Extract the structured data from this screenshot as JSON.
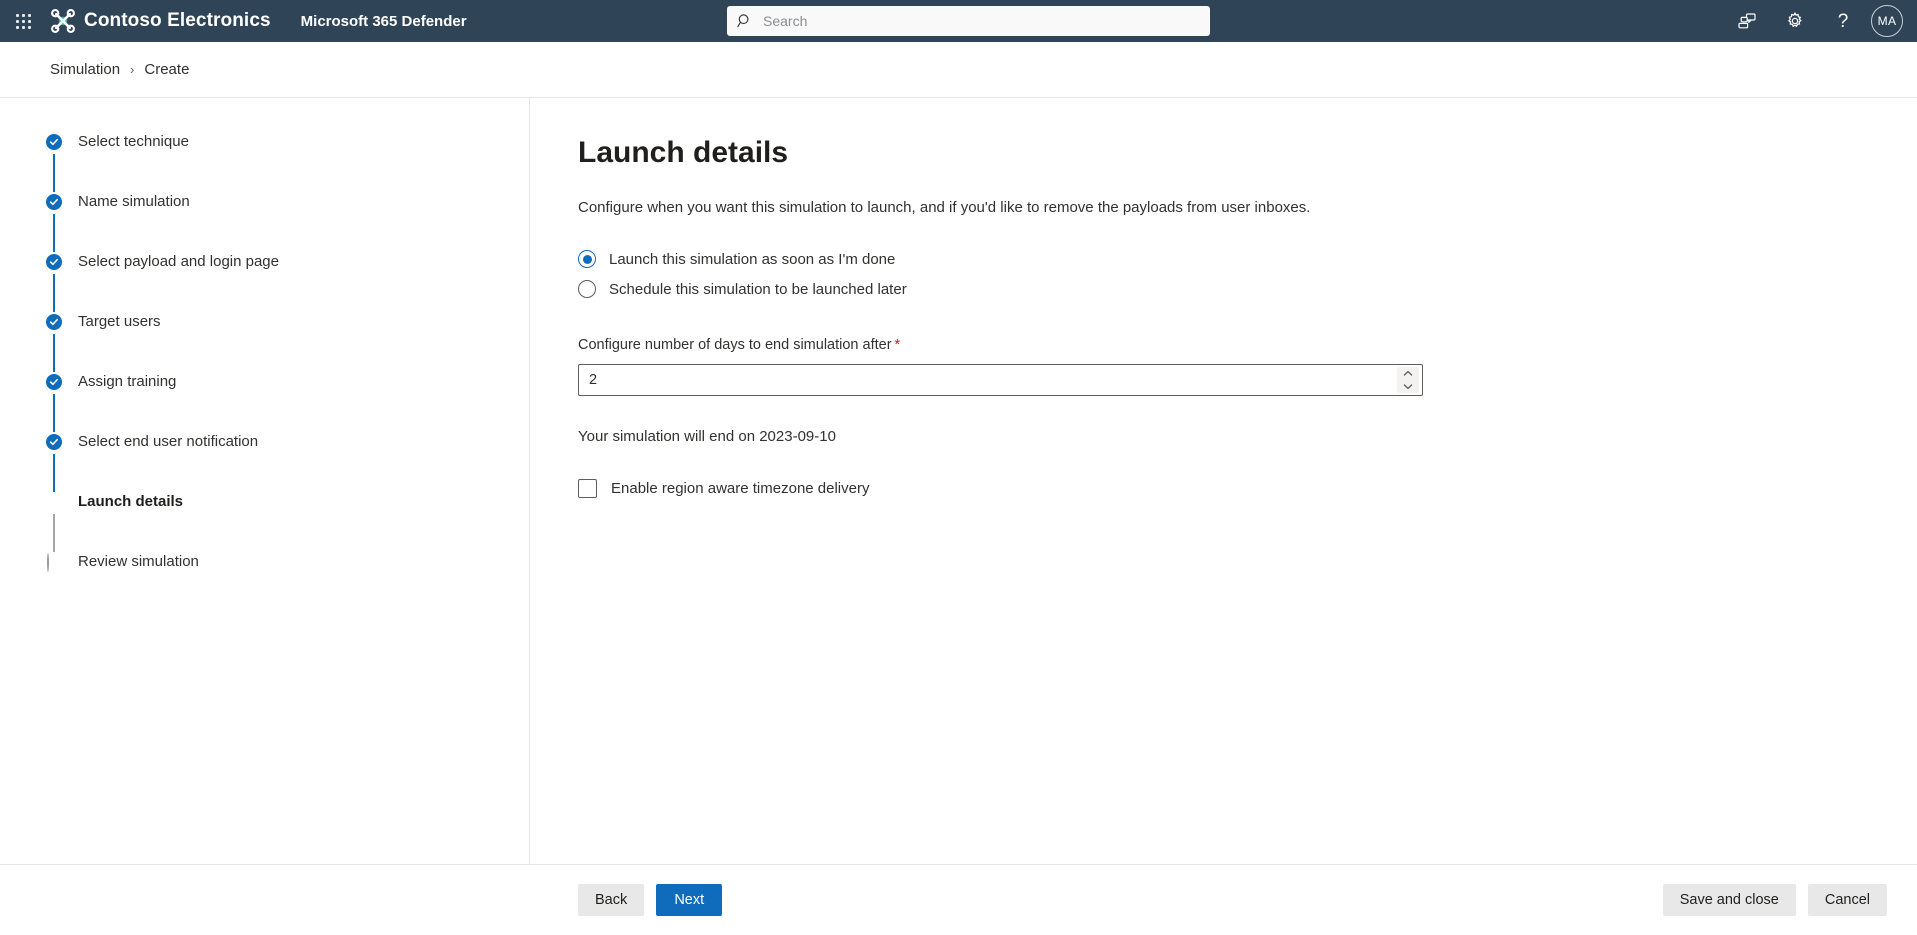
{
  "header": {
    "waffle_label": "App launcher",
    "brand_name": "Contoso Electronics",
    "app_name": "Microsoft 365 Defender",
    "search": {
      "placeholder": "Search",
      "value": ""
    },
    "actions": {
      "feedback_label": "Feedback",
      "settings_label": "Settings",
      "help_label": "?",
      "avatar_initials": "MA"
    },
    "background_color": "#2f4456"
  },
  "breadcrumb": {
    "separator": "›",
    "items": [
      {
        "label": "Simulation"
      },
      {
        "label": "Create"
      }
    ]
  },
  "wizard": {
    "steps": [
      {
        "label": "Select technique",
        "state": "done"
      },
      {
        "label": "Name simulation",
        "state": "done"
      },
      {
        "label": "Select payload and login page",
        "state": "done"
      },
      {
        "label": "Target users",
        "state": "done"
      },
      {
        "label": "Assign training",
        "state": "done"
      },
      {
        "label": "Select end user notification",
        "state": "done"
      },
      {
        "label": "Launch details",
        "state": "current"
      },
      {
        "label": "Review simulation",
        "state": "todo"
      }
    ],
    "accent_color": "#0f6cbd",
    "pending_color": "#a6a6a6"
  },
  "main": {
    "title": "Launch details",
    "description": "Configure when you want this simulation to launch, and if you'd like to remove the payloads from user inboxes.",
    "launch_options": [
      {
        "label": "Launch this simulation as soon as I'm done",
        "checked": true
      },
      {
        "label": "Schedule this simulation to be launched later",
        "checked": false
      }
    ],
    "days_field": {
      "label": "Configure number of days to end simulation after",
      "required_marker": "*",
      "value": "2",
      "placeholder": ""
    },
    "end_date_text": "Your simulation will end on 2023-09-10",
    "timezone_checkbox": {
      "label": "Enable region aware timezone delivery",
      "checked": false
    }
  },
  "footer": {
    "back_label": "Back",
    "next_label": "Next",
    "save_and_close_label": "Save and close",
    "cancel_label": "Cancel",
    "primary_color": "#0f6cbd"
  }
}
